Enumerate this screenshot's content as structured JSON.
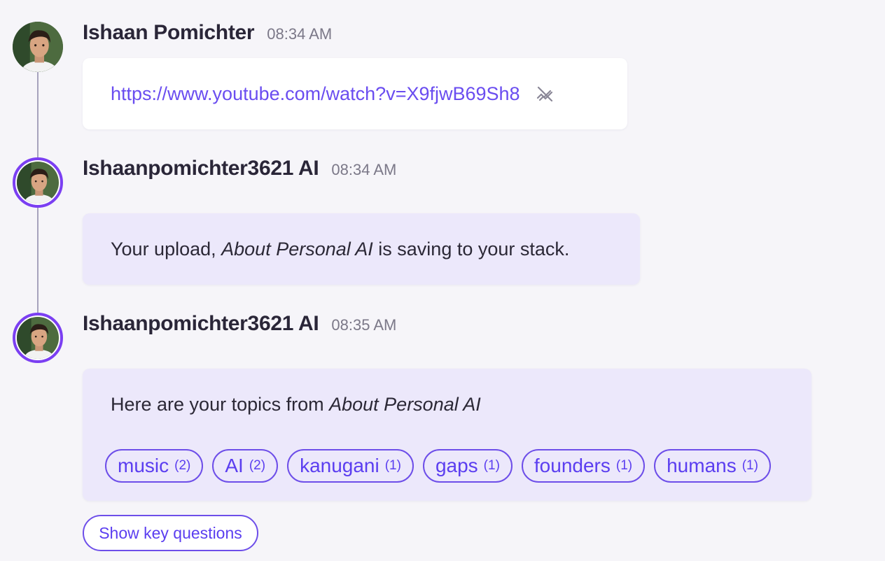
{
  "messages": [
    {
      "author": "Ishaan Pomichter",
      "time": "08:34 AM",
      "link": "https://www.youtube.com/watch?v=X9fjwB69Sh8",
      "link_icon": "unlink-icon"
    },
    {
      "author": "Ishaanpomichter3621 AI",
      "time": "08:34 AM",
      "text_before": "Your upload, ",
      "text_title": "About Personal AI",
      "text_after": " is saving to your stack."
    },
    {
      "author": "Ishaanpomichter3621 AI",
      "time": "08:35 AM",
      "text_before": "Here are your topics from ",
      "text_title": "About Personal AI",
      "topics": [
        {
          "label": "music",
          "count": "(2)"
        },
        {
          "label": "AI",
          "count": "(2)"
        },
        {
          "label": "kanugani",
          "count": "(1)"
        },
        {
          "label": "gaps",
          "count": "(1)"
        },
        {
          "label": "founders",
          "count": "(1)"
        },
        {
          "label": "humans",
          "count": "(1)"
        }
      ]
    }
  ],
  "actions": {
    "key_questions": "Show key questions"
  },
  "colors": {
    "accent": "#6d4ee9",
    "ai_ring": "#7b3ff2",
    "ai_bubble": "#ece8fb",
    "background": "#f6f5f9"
  }
}
